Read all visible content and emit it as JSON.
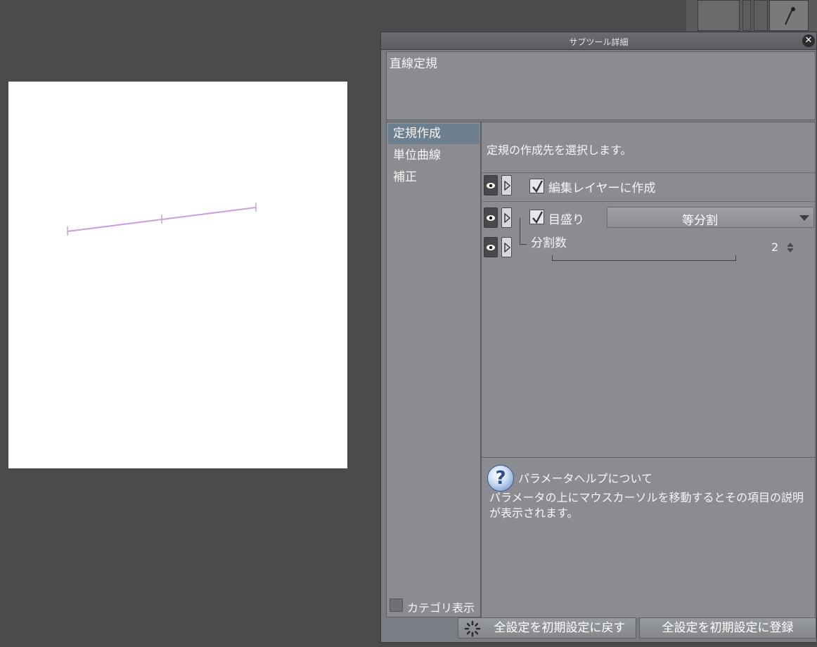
{
  "dialog": {
    "title": "サブツール詳細",
    "tool_name": "直線定規"
  },
  "categories": [
    {
      "label": "定規作成",
      "selected": true
    },
    {
      "label": "単位曲線",
      "selected": false
    },
    {
      "label": "補正",
      "selected": false
    }
  ],
  "category_display": {
    "label": "カテゴリ表示",
    "checked": false
  },
  "main": {
    "description": "定規の作成先を選択します。",
    "options": {
      "create_on_edit_layer": {
        "label": "編集レイヤーに作成",
        "checked": true
      },
      "scale": {
        "label": "目盛り",
        "checked": true,
        "mode": "等分割"
      },
      "division_count": {
        "label": "分割数",
        "value": "2"
      }
    }
  },
  "help": {
    "title": "パラメータヘルプについて",
    "body": "パラメータの上にマウスカーソルを移動するとその項目の説明が表示されます。"
  },
  "buttons": {
    "reset": "全設定を初期設定に戻す",
    "register": "全設定を初期設定に登録"
  },
  "colors": {
    "ruler_line": "#c8a0e0",
    "workspace_bg": "#4b4b4b",
    "selected_category": "#6d8090"
  },
  "icons": [
    "close-icon",
    "eye-icon",
    "expand-triangle-icon",
    "check-icon",
    "help-question-icon",
    "reset-spinner-icon",
    "pen-tool-icon"
  ]
}
